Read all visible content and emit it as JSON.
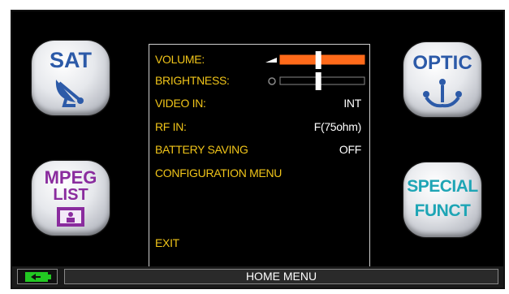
{
  "buttons": {
    "sat": {
      "label": "SAT",
      "color": "#2c5aa8"
    },
    "optic": {
      "label": "OPTIC",
      "color": "#2c5aa8"
    },
    "mpeg": {
      "line1": "MPEG",
      "line2": "LIST",
      "color": "#8a2c9e"
    },
    "special": {
      "line1": "SPECIAL",
      "line2": "FUNCT",
      "color": "#1ea5b5"
    }
  },
  "menu": {
    "volume": {
      "label": "VOLUME:",
      "level": 0.42
    },
    "brightness": {
      "label": "BRIGHTNESS:",
      "level": 0.42
    },
    "video_in": {
      "label": "VIDEO IN:",
      "value": "INT"
    },
    "rf_in": {
      "label": "RF IN:",
      "value": "F(75ohm)"
    },
    "battery_saving": {
      "label": "BATTERY SAVING",
      "value": "OFF"
    },
    "configuration": {
      "label": "CONFIGURATION MENU"
    },
    "exit": {
      "label": "EXIT"
    }
  },
  "status_bar": {
    "title": "HOME MENU",
    "battery_icon": "battery-charging-icon"
  },
  "colors": {
    "menu_label": "#f0c419",
    "slider_fill": "#ff6a1a",
    "battery_green": "#22c822"
  }
}
